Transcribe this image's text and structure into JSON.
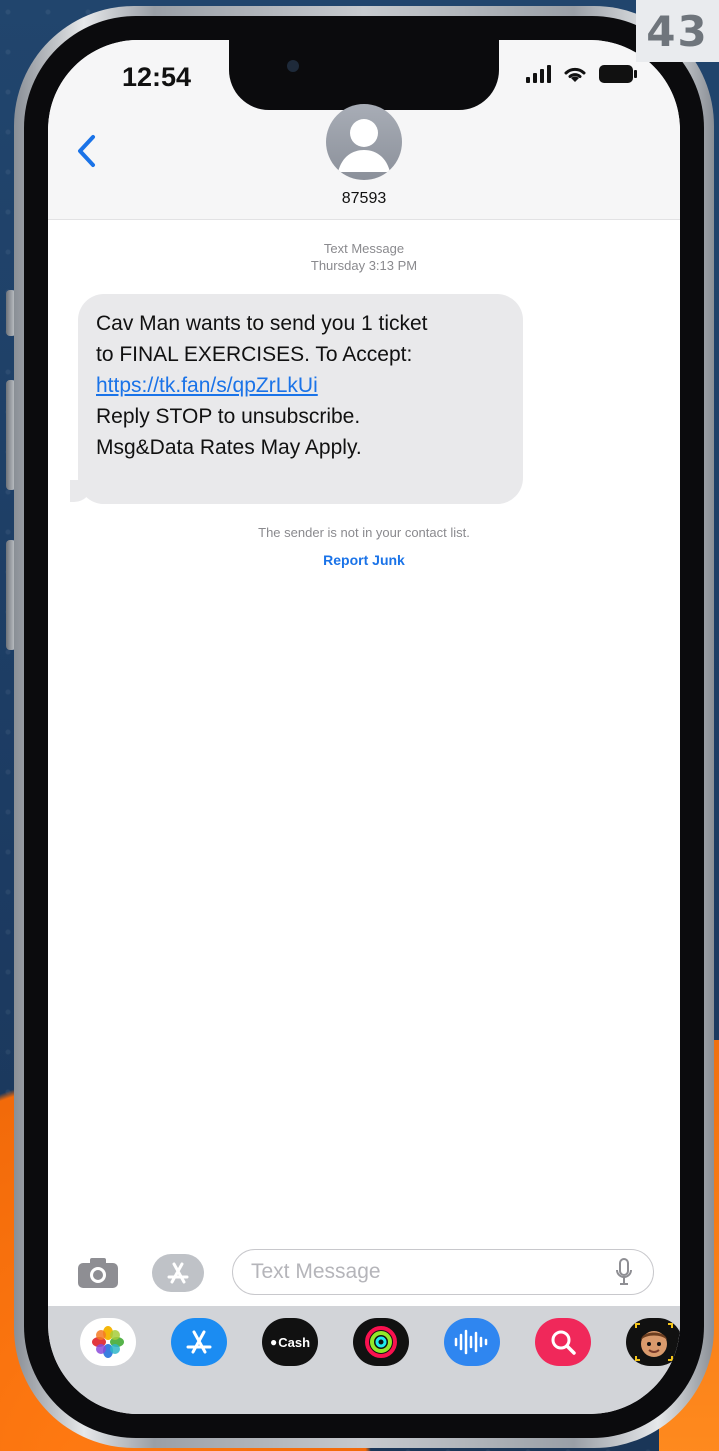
{
  "page_number": "43",
  "status_bar": {
    "time": "12:54"
  },
  "conversation": {
    "contact_name": "87593",
    "meta_type": "Text Message",
    "meta_time": "Thursday 3:13 PM",
    "message": {
      "line1": "Cav Man wants to send you 1 ticket",
      "line2": "to FINAL EXERCISES. To Accept:",
      "link": "https://tk.fan/s/qpZrLkUi",
      "line4": "Reply STOP to unsubscribe.",
      "line5": "Msg&Data Rates May Apply."
    },
    "sender_note": "The sender is not in your contact list.",
    "report_junk_label": "Report Junk"
  },
  "input": {
    "placeholder": "Text Message"
  },
  "app_drawer": {
    "apps": [
      "photos-icon",
      "app-store-icon",
      "apple-cash-icon",
      "activity-icon",
      "audio-icon",
      "search-web-icon",
      "memoji-icon",
      "memoji-stickers-icon"
    ],
    "cash_label": "Cash"
  },
  "colors": {
    "link": "#1a73e8",
    "bubble": "#e9e9eb",
    "accent_orange": "#f26a0a",
    "background_blue": "#1d3f66"
  }
}
